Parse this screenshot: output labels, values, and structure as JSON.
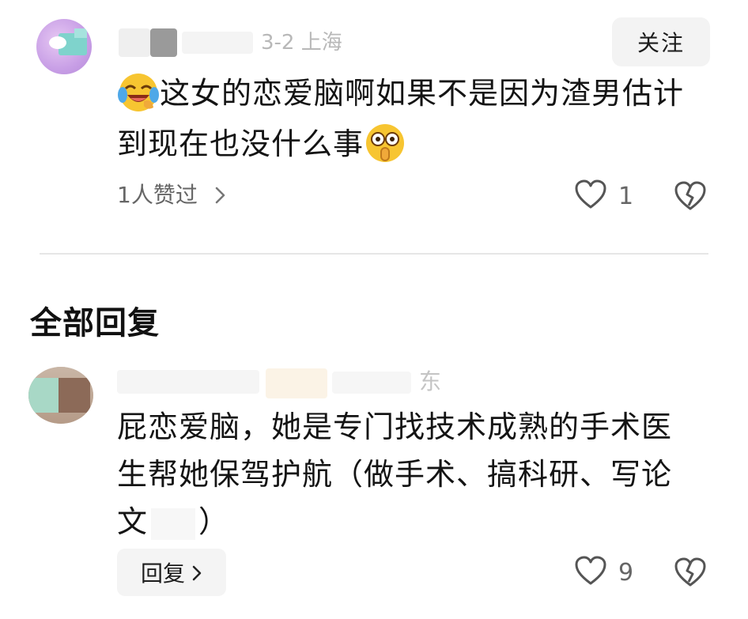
{
  "top_comment": {
    "meta_visible": "3-2  上海",
    "follow_label": "关注",
    "text_a": "这女的恋爱脑啊如果不是因为渣男估计",
    "text_b": "到现在也没什么事",
    "liked_by": "1人赞过",
    "like_count": "1"
  },
  "section_title": "全部回复",
  "reply": {
    "meta_visible": "东",
    "text_line1": "屁恋爱脑，她是专门找技术成熟的手术医",
    "text_line2": "生帮她保驾护航（做手术、搞科研、写论",
    "text_line3_a": "文",
    "text_line3_b": "）",
    "reply_label": "回复",
    "like_count": "9"
  },
  "icons": {
    "chevron": "chevron-right-icon",
    "like": "heart-outline-icon",
    "dislike": "broken-heart-icon",
    "emoji_1": "laughing-crying-emoji-icon",
    "emoji_2": "shocked-face-emoji-icon"
  },
  "colors": {
    "text_primary": "#141414",
    "text_secondary": "#666666",
    "button_bg": "#f3f3f3",
    "divider": "#e6e6e6"
  }
}
